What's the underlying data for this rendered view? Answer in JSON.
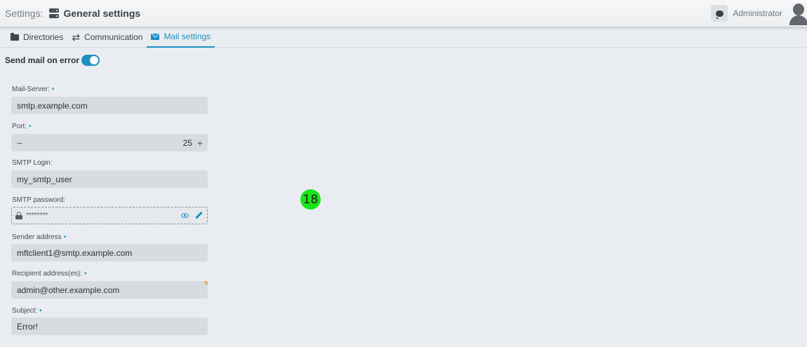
{
  "header": {
    "crumb_prefix": "Settings:",
    "title": "General settings",
    "user_name": "Administrator"
  },
  "tabs": [
    {
      "label": "Directories",
      "icon": "folder-open-icon",
      "active": false
    },
    {
      "label": "Communication",
      "icon": "exchange-arrows-icon",
      "active": false
    },
    {
      "label": "Mail settings",
      "icon": "envelope-icon",
      "active": true
    }
  ],
  "toggle": {
    "label": "Send mail on error",
    "on": true
  },
  "form": {
    "mail_server": {
      "label": "Mail-Server:",
      "required_mark": "•",
      "value": "smtp.example.com"
    },
    "port": {
      "label": "Port:",
      "required_mark": "•",
      "value": "25",
      "minus": "−",
      "plus": "+"
    },
    "smtp_login": {
      "label": "SMTP Login:",
      "value": "my_smtp_user"
    },
    "smtp_password": {
      "label": "SMTP password:",
      "value": "********"
    },
    "sender": {
      "label": "Sender address",
      "required_mark": "•",
      "value": "mftclient1@smtp.example.com"
    },
    "recipient": {
      "label": "Recipient address(es):",
      "required_mark": "•",
      "value": "admin@other.example.com"
    },
    "subject": {
      "label": "Subject:",
      "required_mark": "•",
      "value": "Error!"
    }
  },
  "marker": {
    "label": "18"
  },
  "colors": {
    "accent": "#1d8fc2",
    "background": "#e9edf1",
    "input_bg": "#d8dbdf",
    "marker": "#18e51a",
    "warning_corner": "#e8a33d"
  }
}
